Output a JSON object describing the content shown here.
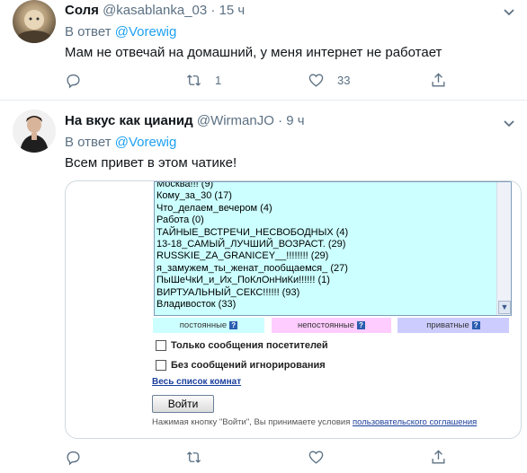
{
  "tweet1": {
    "name": "Соля",
    "handle": "@kasablanka_03",
    "dot": "·",
    "time": "15 ч",
    "reply_prefix": "В ответ",
    "reply_handle": "@Vorewig",
    "text": "Мам не отвечай на домашний, у меня интернет не работает",
    "retweets": "1",
    "likes": "33"
  },
  "tweet2": {
    "name": "На вкус как цианид",
    "handle": "@WirmanJO",
    "dot": "·",
    "time": "9 ч",
    "reply_prefix": "В ответ",
    "reply_handle": "@Vorewig",
    "text": "Всем привет в этом чатике!",
    "retweets": "",
    "likes": ""
  },
  "widget": {
    "rooms": [
      "Москва!!! (9)",
      "Кому_за_30 (17)",
      "Что_делаем_вечером (4)",
      "Работа (0)",
      "ТАЙНЫЕ_ВСТРЕЧИ_НЕСВОБОДНЫХ (4)",
      "13-18_САМЫЙ_ЛУЧШИЙ_ВОЗРАСТ. (29)",
      "RUSSKIE_ZA_GRANICEY__!!!!!!!! (29)",
      "я_замужем_ты_женат_пообщаемся_ (27)",
      "ПыШеЧкИ_и_Их_ПоКлОнНиКи!!!!!! (1)",
      "ВИРТУАЛЬНЫЙ_СЕКС!!!!!! (93)",
      "Владивосток (33)"
    ],
    "categories": [
      {
        "label": "постоянные",
        "color": "#ccffff"
      },
      {
        "label": "непостоянные",
        "color": "#ffccff"
      },
      {
        "label": "приватные",
        "color": "#ccccff"
      }
    ],
    "help_mark": "?",
    "checkbox_visitors": "Только сообщения посетителей",
    "checkbox_ignored": "Без сообщений игнорирования",
    "all_rooms_link": "Весь список комнат",
    "login_button": "Войти",
    "note_text": "Нажимая кнопку \"Войти\", Вы принимаете условия ",
    "note_link": "пользовательского соглашения"
  },
  "colors": {
    "accent": "#1da1f2",
    "muted": "#5b7083",
    "text": "#0f1419"
  }
}
